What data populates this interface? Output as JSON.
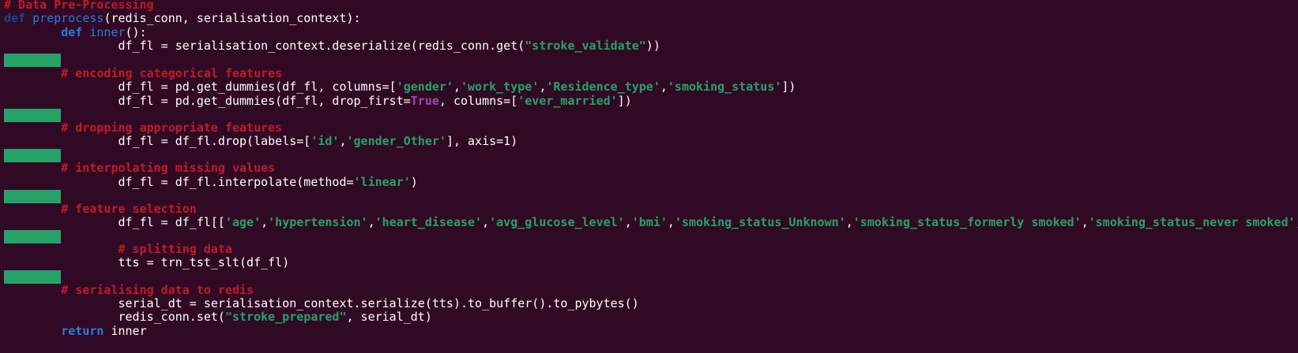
{
  "code": {
    "l01": "# Data Pre-Processing",
    "l02_kw": "def",
    "l02_fn": "preprocess",
    "l02_rest": "(redis_conn, serialisation_context):",
    "l03_kw": "def",
    "l03_fn": "inner",
    "l03_rest": "():",
    "l04_a": "df_fl = serialisation_context.deserialize(redis_conn.get(",
    "l04_s": "\"stroke_validate\"",
    "l04_b": "))",
    "l06": "# encoding categorical features",
    "l07_a": "df_fl = pd.get_dummies(df_fl, columns=[",
    "l07_s1": "'gender'",
    "l07_c1": ",",
    "l07_s2": "'work_type'",
    "l07_c2": ",",
    "l07_s3": "'Residence_type'",
    "l07_c3": ",",
    "l07_s4": "'smoking_status'",
    "l07_b": "])",
    "l08_a": "df_fl = pd.get_dummies(df_fl, drop_first=",
    "l08_bool": "True",
    "l08_b": ", columns=[",
    "l08_s": "'ever_married'",
    "l08_c": "])",
    "l10": "# dropping appropriate features",
    "l11_a": "df_fl = df_fl.drop(labels=[",
    "l11_s1": "'id'",
    "l11_c1": ",",
    "l11_s2": "'gender_Other'",
    "l11_b": "], axis=1)",
    "l13": "# interpolating missing values",
    "l14_a": "df_fl = df_fl.interpolate(method=",
    "l14_s": "'linear'",
    "l14_b": ")",
    "l16": "# feature selection",
    "l17_a": "df_fl = df_fl[[",
    "l17_s1": "'age'",
    "l17_c1": ",",
    "l17_s2": "'hypertension'",
    "l17_c2": ",",
    "l17_s3": "'heart_disease'",
    "l17_c3": ",",
    "l17_s4": "'avg_glucose_level'",
    "l17_c4": ",",
    "l17_s5": "'bmi'",
    "l17_c5": ",",
    "l17_s6": "'smoking_status_Unknown'",
    "l17_c6": ",",
    "l17_s7": "'smoking_status_formerly smoked'",
    "l17_c7": ",",
    "l17_s8": "'smoking_status_never smoked'",
    "l17_c8": ",",
    "l19": "# splitting data",
    "l20": "tts = trn_tst_slt(df_fl)",
    "l22": "# serialising data to redis",
    "l23": "serial_dt = serialisation_context.serialize(tts).to_buffer().to_pybytes()",
    "l24_a": "redis_conn.set(",
    "l24_s": "\"stroke_prepared\"",
    "l24_b": ", serial_dt)",
    "l25_kw": "return",
    "l25_rest": " inner"
  },
  "colors": {
    "background": "#300a24",
    "comment": "#c01c28",
    "keyword": "#12488b",
    "function": "#2a7bde",
    "string": "#26a269",
    "boolean": "#a347ba",
    "whitespace_marker": "#26a269"
  }
}
